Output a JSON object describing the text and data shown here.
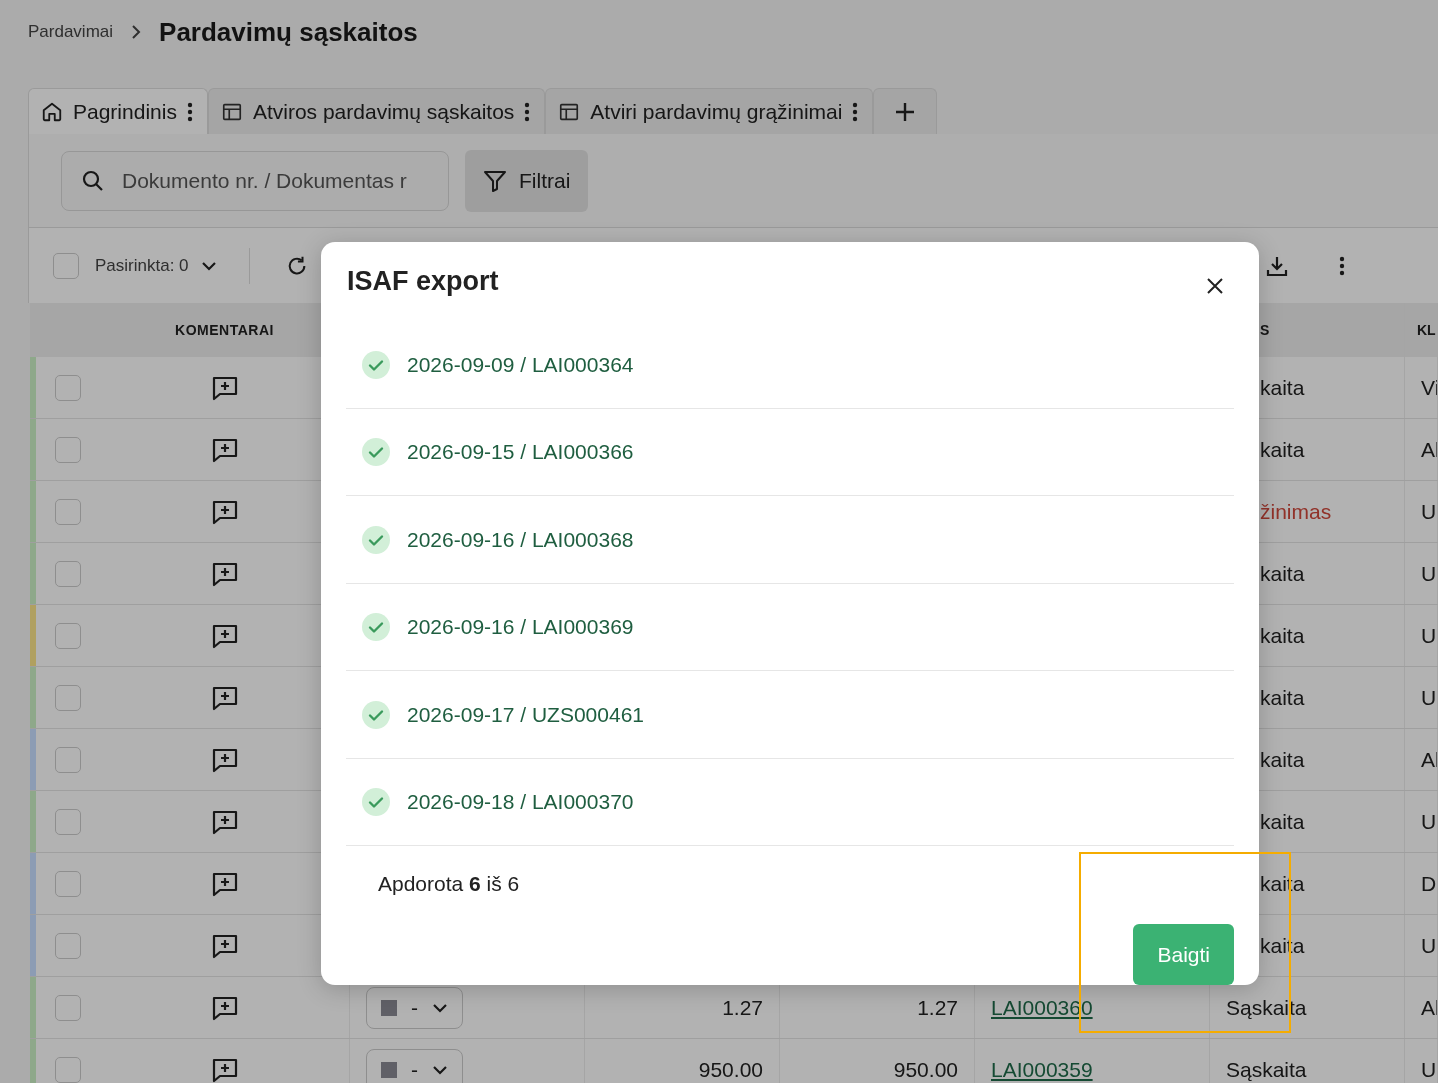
{
  "breadcrumb": {
    "parent": "Pardavimai",
    "title": "Pardavimų sąskaitos"
  },
  "tabs": [
    {
      "label": "Pagrindinis",
      "kind": "home",
      "selected": true
    },
    {
      "label": "Atviros pardavimų sąskaitos",
      "kind": "view",
      "selected": false
    },
    {
      "label": "Atviri pardavimų grąžinimai",
      "kind": "view",
      "selected": false
    }
  ],
  "search": {
    "placeholder": "Dokumento nr. / Dokumentas r"
  },
  "filter_button": "Filtrai",
  "toolbar": {
    "select_all_checked": false,
    "selected_label": "Pasirinkta: 0"
  },
  "table": {
    "columns": [
      "KOMENTARAI",
      "S",
      "KL"
    ],
    "rows": [
      {
        "color": "#8ea88a",
        "checked": false,
        "kind": "invoice",
        "type": "kaita",
        "client": "Vi"
      },
      {
        "color": "#8ea88a",
        "checked": false,
        "kind": "invoice",
        "type": "kaita",
        "client": "Al"
      },
      {
        "color": "#8ea88a",
        "checked": false,
        "kind": "return",
        "type": "žinimas",
        "client": "U"
      },
      {
        "color": "#8ea88a",
        "checked": false,
        "kind": "invoice",
        "type": "kaita",
        "client": "U"
      },
      {
        "color": "#b0a060",
        "checked": false,
        "kind": "invoice",
        "type": "kaita",
        "client": "U"
      },
      {
        "color": "#8ea88a",
        "checked": false,
        "kind": "invoice",
        "type": "kaita",
        "client": "U"
      },
      {
        "color": "#8c9cb4",
        "checked": false,
        "kind": "invoice",
        "type": "kaita",
        "client": "Al"
      },
      {
        "color": "#8ea88a",
        "checked": false,
        "kind": "invoice",
        "type": "kaita",
        "client": "U"
      },
      {
        "color": "#8c9cb4",
        "checked": false,
        "kind": "invoice",
        "type": "kaita",
        "client": "D"
      },
      {
        "color": "#8c9cb4",
        "checked": false,
        "kind": "invoice",
        "type": "kaita",
        "client": "U"
      },
      {
        "color": "#8ea88a",
        "checked": false,
        "kind": "invoice",
        "status": "-",
        "amount": "1.27",
        "total": "1.27",
        "document": "LAI000360",
        "type": "Sąskaita",
        "client": "Al"
      },
      {
        "color": "#8ea88a",
        "checked": false,
        "kind": "invoice",
        "status": "-",
        "amount": "950.00",
        "total": "950.00",
        "document": "LAI000359",
        "type": "Sąskaita",
        "client": "U"
      }
    ]
  },
  "modal": {
    "title": "ISAF export",
    "items": [
      {
        "label": "2026-09-09 / LAI000364",
        "done": true
      },
      {
        "label": "2026-09-15 / LAI000366",
        "done": true
      },
      {
        "label": "2026-09-16 / LAI000368",
        "done": true
      },
      {
        "label": "2026-09-16 / LAI000369",
        "done": true
      },
      {
        "label": "2026-09-17 / UZS000461",
        "done": true
      },
      {
        "label": "2026-09-18 / LAI000370",
        "done": true
      }
    ],
    "summary": "Apdorota **6** iš 6",
    "button": "Baigti"
  }
}
